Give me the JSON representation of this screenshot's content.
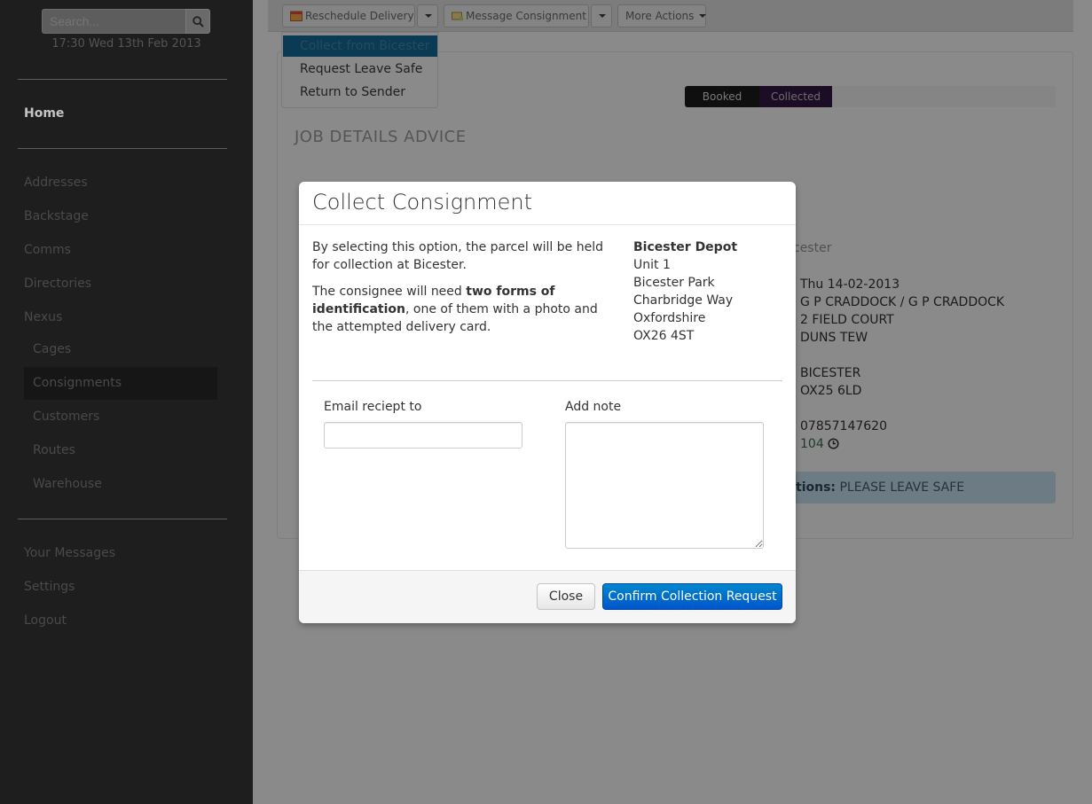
{
  "sidebar": {
    "search_placeholder": "Search...",
    "datetime": "17:30 Wed 13th Feb 2013",
    "nav": {
      "home": "Home",
      "addresses": "Addresses",
      "backstage": "Backstage",
      "comms": "Comms",
      "directories": "Directories",
      "nexus": "Nexus",
      "cages": "Cages",
      "consignments": "Consignments",
      "customers": "Customers",
      "routes": "Routes",
      "warehouse": "Warehouse",
      "your_messages": "Your Messages",
      "settings": "Settings",
      "logout": "Logout"
    }
  },
  "toolbar": {
    "reschedule": "Reschedule Delivery",
    "message": "Message Consignment",
    "more": "More Actions"
  },
  "dropdown": {
    "items": [
      "Collect from Bicester",
      "Request Leave Safe",
      "Return to Sender"
    ],
    "active_index": 0
  },
  "job": {
    "title": "JOB DETAILS ADVICE",
    "status": {
      "booked": "Booked",
      "collected": "Collected"
    },
    "depot_partial": "cester",
    "details": {
      "date": "Thu 14-02-2013",
      "name": "G P CRADDOCK / G P CRADDOCK",
      "address1": "2 FIELD COURT",
      "address2": "DUNS TEW",
      "town": "BICESTER",
      "postcode": "OX25 6LD",
      "phone": "07857147620",
      "code": "104"
    },
    "instructions_label": "tions:",
    "instructions_value": "PLEASE LEAVE SAFE"
  },
  "modal": {
    "title": "Collect Consignment",
    "p1": "By selecting this option, the parcel will be held for collection at Bicester.",
    "p2_before": "The consignee will need ",
    "p2_bold": "two forms of identification",
    "p2_after": ", one of them with a photo and the attempted delivery card.",
    "address": {
      "name": "Bicester Depot",
      "line1": "Unit 1",
      "line2": "Bicester Park",
      "line3": "Charbridge Way",
      "line4": "Oxfordshire",
      "postcode": "OX26 4ST"
    },
    "email_label": "Email reciept to",
    "email_value": "",
    "note_label": "Add note",
    "note_value": "",
    "close_label": "Close",
    "confirm_label": "Confirm Collection Request"
  },
  "colors": {
    "primary_button": "#0066cc",
    "status_collected": "#3a1a4f",
    "dropdown_active": "#0b3a55"
  }
}
